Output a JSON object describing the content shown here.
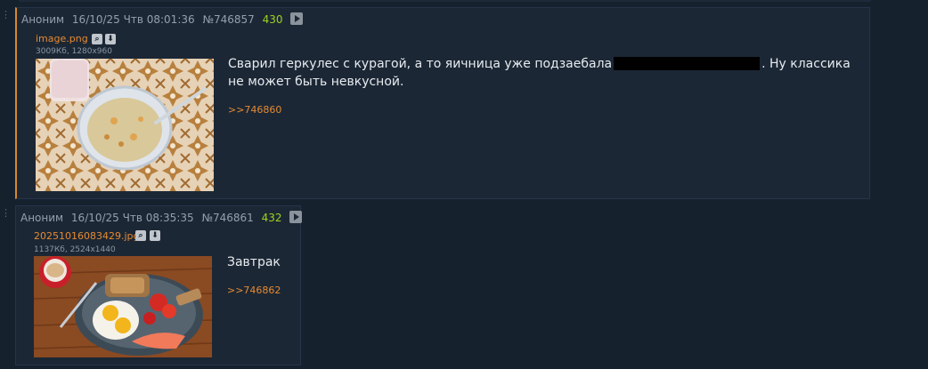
{
  "posts": [
    {
      "author": "Аноним",
      "date": "16/10/25 Чтв 08:01:36",
      "id": "№746857",
      "count": "430",
      "file": {
        "name": "image.png",
        "meta": "3009Кб, 1280x960"
      },
      "text_before": "Сварил геркулес с курагой, а то яичница уже подзаебала",
      "text_after": ". Ну классика не может быть невкусной.",
      "reply": ">>746860"
    },
    {
      "author": "Аноним",
      "date": "16/10/25 Чтв 08:35:35",
      "id": "№746861",
      "count": "432",
      "file": {
        "name": "20251016083429.jpg",
        "meta": "1137Кб, 2524x1440"
      },
      "text": "Завтрак",
      "reply": ">>746862"
    }
  ],
  "colors": {
    "accent": "#d6892b",
    "post_number": "#9bd31f",
    "link": "#e58a32",
    "background": "#16212e",
    "post_bg": "#1c2735"
  },
  "icons": [
    "search-icon",
    "download-icon",
    "play-icon"
  ]
}
